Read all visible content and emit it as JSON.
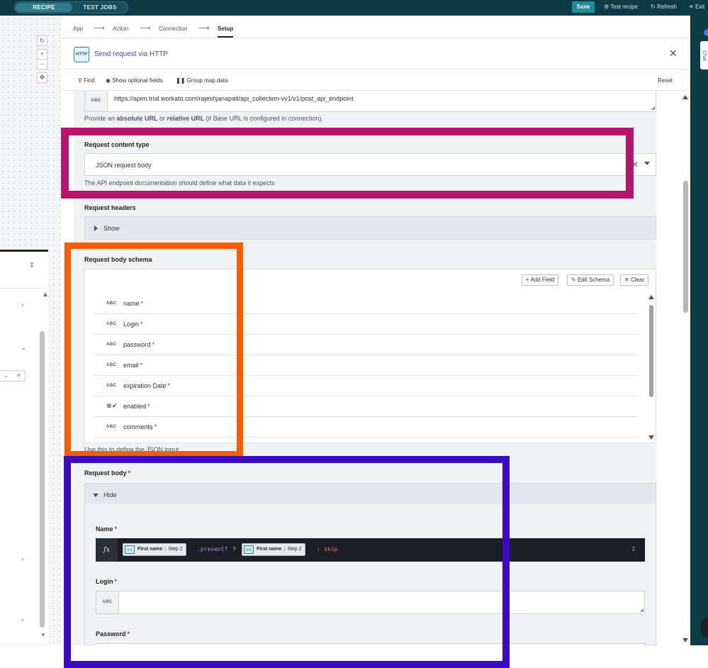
{
  "top": {
    "toggle_recipe": "RECIPE",
    "toggle_test_jobs": "TEST JOBS",
    "save": "Save",
    "test_recipe": "Test recipe",
    "refresh": "Refresh",
    "exit": "Exit"
  },
  "breadcrumb": [
    "App",
    "Action",
    "Connection",
    "Setup"
  ],
  "header": {
    "icon_text": "HTTP",
    "title_action": "Send request",
    "title_via": "via",
    "title_app": "HTTP"
  },
  "toolbar": {
    "find": "Find",
    "show_optional": "Show optional fields",
    "group_map": "Group map data",
    "reset": "Reset"
  },
  "url": {
    "type": "ABC",
    "value": "https://apim.trial.workato.com/rajeshjanapati/api_collection-vv1/v1/post_api_endpoint",
    "hint_pre": "Provide an ",
    "hint_abs": "absolute URL",
    "hint_or": " or ",
    "hint_rel": "relative URL",
    "hint_post": " (if Base URL is configured in connection)."
  },
  "content_type": {
    "label": "Request content type",
    "value": "JSON request body",
    "hint": "The API endpoint documentation should define what data it expects"
  },
  "headers": {
    "label": "Request headers",
    "toggle": "Show"
  },
  "schema": {
    "label": "Request body schema",
    "add_field": "+ Add Field",
    "edit_schema": "Edit Schema",
    "clear": "Clear",
    "fields": [
      {
        "type": "ABC",
        "name": "name"
      },
      {
        "type": "ABC",
        "name": "Login"
      },
      {
        "type": "ABC",
        "name": "password"
      },
      {
        "type": "ABC",
        "name": "email"
      },
      {
        "type": "ABC",
        "name": "expiration Date"
      },
      {
        "type": "BOOL",
        "name": "enabled"
      },
      {
        "type": "ABC",
        "name": "comments"
      }
    ],
    "hint": "Use this to define the JSON input."
  },
  "body": {
    "label": "Request body",
    "toggle": "Hide",
    "name_label": "Name",
    "pill_field": "First name",
    "pill_step": "Step 2",
    "pill_icon": "{io}",
    "code_present": ".present?",
    "code_q": "?",
    "code_colon": ":",
    "code_skip": "skip",
    "fx": "fx",
    "login_label": "Login",
    "login_type": "ABC",
    "password_label": "Password"
  },
  "chat_tab": "Chat",
  "colors": {
    "topbar": "#0d3b45",
    "accent": "#1f8b9a",
    "link": "#3b4bb8",
    "required": "#d0232f",
    "annot_magenta": "#b5166b",
    "annot_orange": "#ff5c00",
    "annot_purple": "#3d0ac4"
  }
}
